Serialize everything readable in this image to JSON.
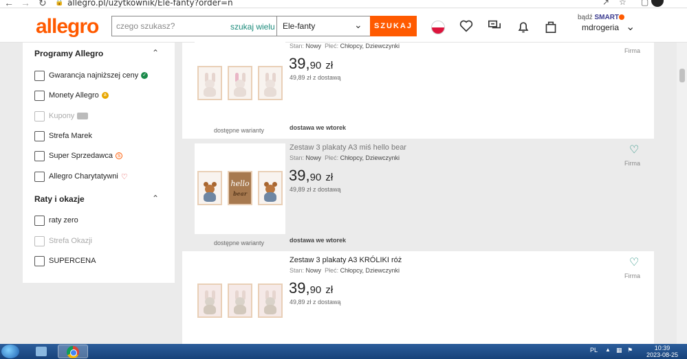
{
  "browser": {
    "url": "allegro.pl/uzytkownik/Ele-fanty?order=n"
  },
  "header": {
    "logo": "allegro",
    "search_placeholder": "czego szukasz?",
    "search_multi": "szukaj wielu",
    "search_scope": "Ele-fanty",
    "search_button": "SZUKAJ",
    "smart_prefix": "bądź",
    "smart_label": "SMART",
    "username": "mdrogeria"
  },
  "sidebar": {
    "section1_title": "Programy Allegro",
    "section1_items": [
      {
        "label": "Gwarancja najniższej ceny",
        "disabled": false
      },
      {
        "label": "Monety Allegro",
        "disabled": false
      },
      {
        "label": "Kupony",
        "disabled": true
      },
      {
        "label": "Strefa Marek",
        "disabled": false
      },
      {
        "label": "Super Sprzedawca",
        "disabled": false
      },
      {
        "label": "Allegro Charytatywni",
        "disabled": false
      }
    ],
    "section2_title": "Raty i okazje",
    "section2_items": [
      {
        "label": "raty zero",
        "disabled": false
      },
      {
        "label": "Strefa Okazji",
        "disabled": true
      },
      {
        "label": "SUPERCENA",
        "disabled": false
      }
    ]
  },
  "listings": [
    {
      "title": "",
      "stan_label": "Stan:",
      "stan_value": "Nowy",
      "plec_label": "Płeć:",
      "plec_value": "Chłopcy, Dziewczynki",
      "price_main": "39,",
      "price_cents": "90",
      "price_currency": "zł",
      "delivery_price": "49,89 zł z dostawą",
      "variants": "dostępne warianty",
      "delivery": "dostawa we wtorek",
      "seller_type": "Firma"
    },
    {
      "title": "Zestaw 3 plakaty A3 miś hello bear",
      "stan_label": "Stan:",
      "stan_value": "Nowy",
      "plec_label": "Płeć:",
      "plec_value": "Chłopcy, Dziewczynki",
      "price_main": "39,",
      "price_cents": "90",
      "price_currency": "zł",
      "delivery_price": "49,89 zł z dostawą",
      "variants": "dostępne warianty",
      "delivery": "dostawa we wtorek",
      "seller_type": "Firma",
      "poster_text_1": "hello",
      "poster_text_2": "bear"
    },
    {
      "title": "Zestaw 3 plakaty A3 KRÓLIKI róż",
      "stan_label": "Stan:",
      "stan_value": "Nowy",
      "plec_label": "Płeć:",
      "plec_value": "Chłopcy, Dziewczynki",
      "price_main": "39,",
      "price_cents": "90",
      "price_currency": "zł",
      "delivery_price": "49,89 zł z dostawą",
      "seller_type": "Firma"
    }
  ],
  "taskbar": {
    "language": "PL",
    "time": "10:39",
    "date": "2023-08-25"
  },
  "colors": {
    "brand": "#ff5a00",
    "accent": "#1a8a7a"
  }
}
